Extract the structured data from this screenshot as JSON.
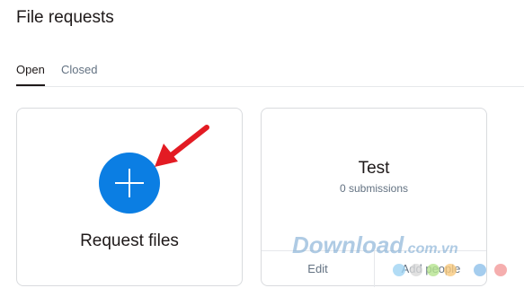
{
  "page": {
    "title": "File requests"
  },
  "tabs": [
    {
      "label": "Open",
      "active": true
    },
    {
      "label": "Closed",
      "active": false
    }
  ],
  "request_card": {
    "label": "Request files",
    "icon": "plus-icon"
  },
  "test_card": {
    "title": "Test",
    "subtitle": "0 submissions",
    "edit_label": "Edit",
    "add_label": "Add people"
  },
  "watermark": {
    "brand": "Download",
    "suffix": ".com.vn"
  },
  "colors": {
    "accent": "#0b7ee3",
    "arrow": "#e31b23",
    "dots": [
      "#9fd3f2",
      "#d9d9d9",
      "#b5e38f",
      "#f7c97e",
      "#8fc0ea",
      "#f39a9a"
    ]
  }
}
